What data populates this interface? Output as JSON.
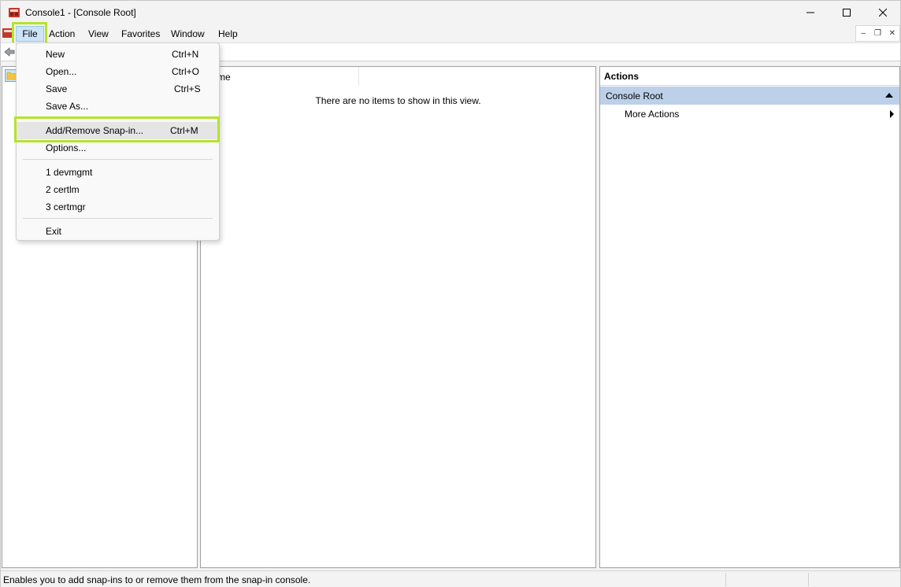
{
  "window": {
    "title": "Console1 - [Console Root]"
  },
  "menubar": {
    "items": [
      "File",
      "Action",
      "View",
      "Favorites",
      "Window",
      "Help"
    ]
  },
  "file_menu": {
    "items": [
      {
        "label": "New",
        "shortcut": "Ctrl+N"
      },
      {
        "label": "Open...",
        "shortcut": "Ctrl+O"
      },
      {
        "label": "Save",
        "shortcut": "Ctrl+S"
      },
      {
        "label": "Save As...",
        "shortcut": ""
      },
      {
        "label": "Add/Remove Snap-in...",
        "shortcut": "Ctrl+M"
      },
      {
        "label": "Options...",
        "shortcut": ""
      },
      {
        "label": "1 devmgmt",
        "shortcut": ""
      },
      {
        "label": "2 certlm",
        "shortcut": ""
      },
      {
        "label": "3 certmgr",
        "shortcut": ""
      },
      {
        "label": "Exit",
        "shortcut": ""
      }
    ]
  },
  "center": {
    "column_header": "me",
    "empty_message": "There are no items to show in this view."
  },
  "actions": {
    "header": "Actions",
    "section": "Console Root",
    "link": "More Actions"
  },
  "statusbar": {
    "text": "Enables you to add snap-ins to or remove them from the snap-in console."
  },
  "colors": {
    "highlight": "#b6e32a",
    "menu_selected": "#cce4f7",
    "actions_section": "#bcd1e9"
  }
}
